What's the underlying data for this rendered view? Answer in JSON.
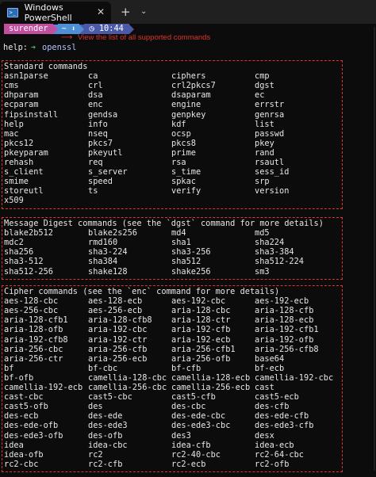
{
  "window": {
    "tab_title": "Windows PowerShell",
    "tab_icon": "powershell-icon",
    "close_glyph": "✕",
    "new_tab_glyph": "+",
    "dropdown_glyph": "⌄"
  },
  "prompt": {
    "user": "surender",
    "path": "~",
    "time": "10:44",
    "command": "openssl",
    "arrow": "⟶",
    "annotation": "View the list of all supported commands"
  },
  "output_first": "help:",
  "sections": [
    {
      "header": "Standard commands",
      "rows": [
        [
          "asn1parse",
          "ca",
          "ciphers",
          "cmp"
        ],
        [
          "cms",
          "crl",
          "crl2pkcs7",
          "dgst"
        ],
        [
          "dhparam",
          "dsa",
          "dsaparam",
          "ec"
        ],
        [
          "ecparam",
          "enc",
          "engine",
          "errstr"
        ],
        [
          "fipsinstall",
          "gendsa",
          "genpkey",
          "genrsa"
        ],
        [
          "help",
          "info",
          "kdf",
          "list"
        ],
        [
          "mac",
          "nseq",
          "ocsp",
          "passwd"
        ],
        [
          "pkcs12",
          "pkcs7",
          "pkcs8",
          "pkey"
        ],
        [
          "pkeyparam",
          "pkeyutl",
          "prime",
          "rand"
        ],
        [
          "rehash",
          "req",
          "rsa",
          "rsautl"
        ],
        [
          "s_client",
          "s_server",
          "s_time",
          "sess_id"
        ],
        [
          "smime",
          "speed",
          "spkac",
          "srp"
        ],
        [
          "storeutl",
          "ts",
          "verify",
          "version"
        ],
        [
          "x509",
          "",
          "",
          ""
        ]
      ]
    },
    {
      "header": "Message Digest commands (see the `dgst` command for more details)",
      "rows": [
        [
          "blake2b512",
          "blake2s256",
          "md4",
          "md5"
        ],
        [
          "mdc2",
          "rmd160",
          "sha1",
          "sha224"
        ],
        [
          "sha256",
          "sha3-224",
          "sha3-256",
          "sha3-384"
        ],
        [
          "sha3-512",
          "sha384",
          "sha512",
          "sha512-224"
        ],
        [
          "sha512-256",
          "shake128",
          "shake256",
          "sm3"
        ]
      ]
    },
    {
      "header": "Cipher commands (see the `enc` command for more details)",
      "rows": [
        [
          "aes-128-cbc",
          "aes-128-ecb",
          "aes-192-cbc",
          "aes-192-ecb"
        ],
        [
          "aes-256-cbc",
          "aes-256-ecb",
          "aria-128-cbc",
          "aria-128-cfb"
        ],
        [
          "aria-128-cfb1",
          "aria-128-cfb8",
          "aria-128-ctr",
          "aria-128-ecb"
        ],
        [
          "aria-128-ofb",
          "aria-192-cbc",
          "aria-192-cfb",
          "aria-192-cfb1"
        ],
        [
          "aria-192-cfb8",
          "aria-192-ctr",
          "aria-192-ecb",
          "aria-192-ofb"
        ],
        [
          "aria-256-cbc",
          "aria-256-cfb",
          "aria-256-cfb1",
          "aria-256-cfb8"
        ],
        [
          "aria-256-ctr",
          "aria-256-ecb",
          "aria-256-ofb",
          "base64"
        ],
        [
          "bf",
          "bf-cbc",
          "bf-cfb",
          "bf-ecb"
        ],
        [
          "bf-ofb",
          "camellia-128-cbc",
          "camellia-128-ecb",
          "camellia-192-cbc"
        ],
        [
          "camellia-192-ecb",
          "camellia-256-cbc",
          "camellia-256-ecb",
          "cast"
        ],
        [
          "cast-cbc",
          "cast5-cbc",
          "cast5-cfb",
          "cast5-ecb"
        ],
        [
          "cast5-ofb",
          "des",
          "des-cbc",
          "des-cfb"
        ],
        [
          "des-ecb",
          "des-ede",
          "des-ede-cbc",
          "des-ede-cfb"
        ],
        [
          "des-ede-ofb",
          "des-ede3",
          "des-ede3-cbc",
          "des-ede3-cfb"
        ],
        [
          "des-ede3-ofb",
          "des-ofb",
          "des3",
          "desx"
        ],
        [
          "idea",
          "idea-cbc",
          "idea-cfb",
          "idea-ecb"
        ],
        [
          "idea-ofb",
          "rc2",
          "rc2-40-cbc",
          "rc2-64-cbc"
        ],
        [
          "rc2-cbc",
          "rc2-cfb",
          "rc2-ecb",
          "rc2-ofb"
        ]
      ]
    }
  ],
  "colors": {
    "user_segment": "#c14fa0",
    "path_segment": "#4e8fd6",
    "time_segment": "#4b5aa8",
    "annotation": "#e0352b",
    "prompt_arrow": "#59b36c",
    "command": "#b8c0ff"
  }
}
